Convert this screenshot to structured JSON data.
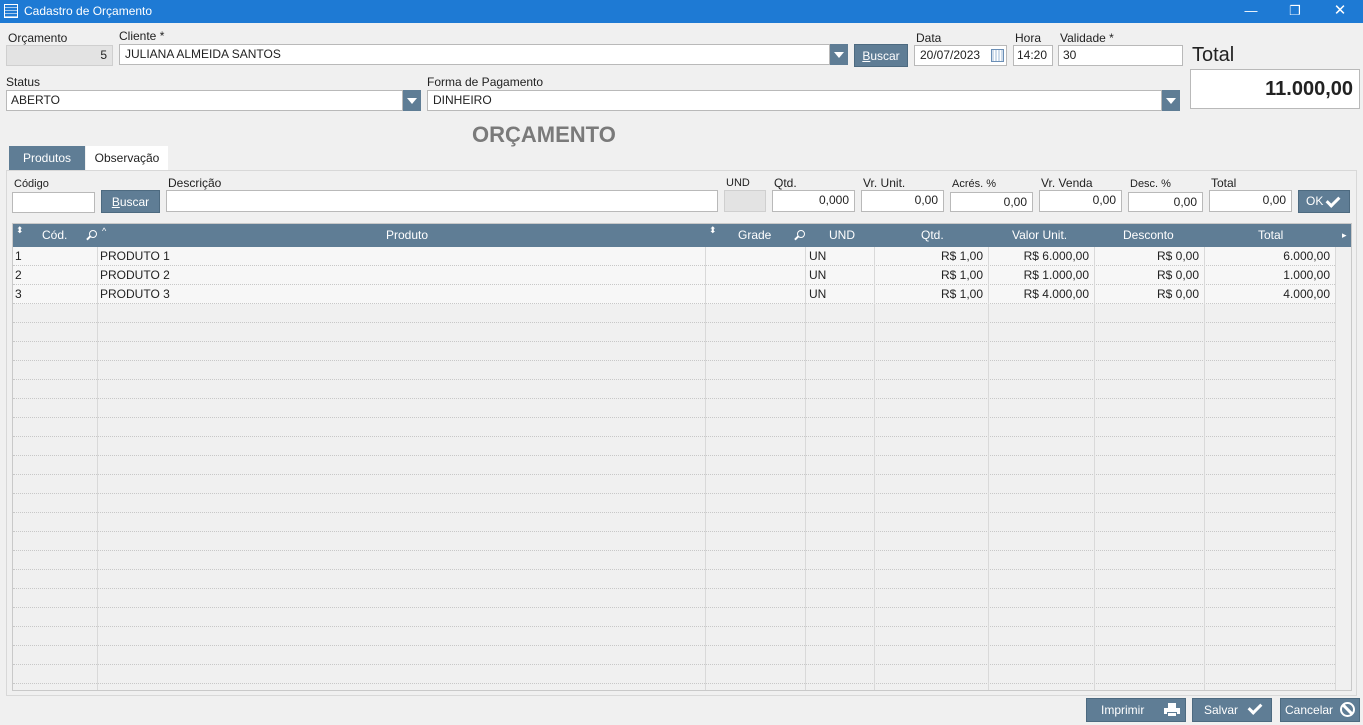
{
  "window": {
    "title": "Cadastro de Orçamento",
    "min": "—",
    "max": "❐",
    "close": "✕"
  },
  "header": {
    "orcamento_label": "Orçamento",
    "orcamento_value": "5",
    "cliente_label": "Cliente *",
    "cliente_value": "JULIANA ALMEIDA SANTOS",
    "buscar_label": "uscar",
    "buscar_hotkey": "B",
    "data_label": "Data",
    "data_value": "20/07/2023",
    "hora_label": "Hora",
    "hora_value": "14:20",
    "validade_label": "Validade *",
    "validade_value": "30",
    "status_label": "Status",
    "status_value": "ABERTO",
    "pagamento_label": "Forma de Pagamento",
    "pagamento_value": "DINHEIRO",
    "total_label": "Total",
    "total_value": "11.000,00"
  },
  "heading": "ORÇAMENTO",
  "tabs": [
    {
      "label": "Produtos"
    },
    {
      "label": "Observação"
    }
  ],
  "entry": {
    "codigo_label": "Código",
    "codigo_value": "",
    "buscar_hotkey": "B",
    "buscar_label": "uscar",
    "descricao_label": "Descrição",
    "descricao_value": "",
    "und_label": "UND",
    "und_value": "",
    "qtd_label": "Qtd.",
    "qtd_value": "0,000",
    "vr_unit_label": "Vr. Unit.",
    "vr_unit_value": "0,00",
    "acres_label": "Acrés. %",
    "acres_value": "0,00",
    "vr_venda_label": "Vr. Venda",
    "vr_venda_value": "0,00",
    "desc_label": "Desc. %",
    "desc_value": "0,00",
    "total_label": "Total",
    "total_value": "0,00",
    "ok_label": "OK"
  },
  "grid": {
    "columns": [
      "Cód.",
      "Produto",
      "Grade",
      "UND",
      "Qtd.",
      "Valor Unit.",
      "Desconto",
      "Total"
    ],
    "rows": [
      {
        "cod": "1",
        "produto": "PRODUTO 1",
        "grade": "",
        "und": "UN",
        "qtd": "R$ 1,00",
        "valor_unit": "R$ 6.000,00",
        "desconto": "R$ 0,00",
        "total": "6.000,00"
      },
      {
        "cod": "2",
        "produto": "PRODUTO 2",
        "grade": "",
        "und": "UN",
        "qtd": "R$ 1,00",
        "valor_unit": "R$ 1.000,00",
        "desconto": "R$ 0,00",
        "total": "1.000,00"
      },
      {
        "cod": "3",
        "produto": "PRODUTO 3",
        "grade": "",
        "und": "UN",
        "qtd": "R$ 1,00",
        "valor_unit": "R$ 4.000,00",
        "desconto": "R$ 0,00",
        "total": "4.000,00"
      }
    ]
  },
  "footer": {
    "imprimir": "Imprimir",
    "salvar": "Salvar",
    "cancelar": "Cancelar"
  },
  "icons": {
    "app": "form-icon",
    "calendar": "calendar-icon",
    "print": "printer-icon",
    "save": "check-icon",
    "cancel": "ban-icon",
    "search": "magnifier-icon"
  }
}
